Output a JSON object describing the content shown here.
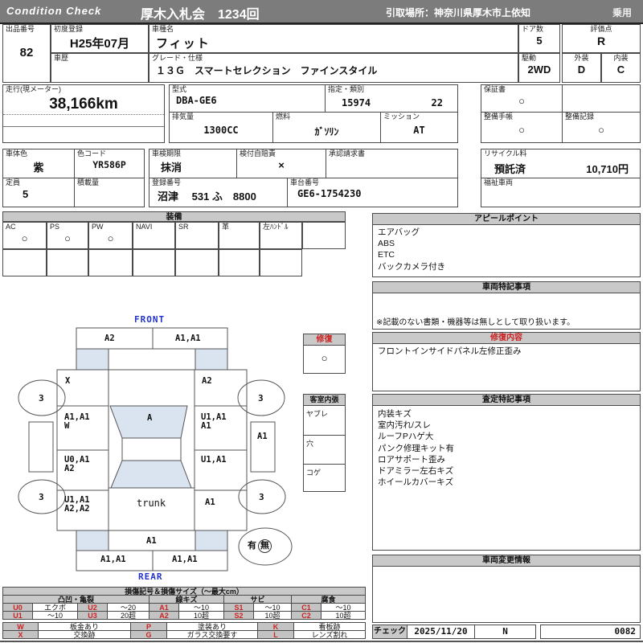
{
  "header": {
    "brand": "Condition  Check",
    "auction": "厚木入札会　1234回",
    "pickup": "引取場所：神奈川県厚木市上依知",
    "category": "乗用"
  },
  "info": {
    "lot_label": "出品番号",
    "lot_value": "82",
    "first_reg_label": "初度登録",
    "first_reg_value": "H25年07月",
    "history_label": "車歴",
    "history_value": "",
    "model_name_label": "車種名",
    "model_name_value": "フィット",
    "grade_label": "グレード・仕様",
    "grade_value": "１３Ｇ　スマートセレクション　ファインスタイル",
    "doors_label": "ドア数",
    "doors_value": "5",
    "drive_label": "駆動",
    "drive_value": "2WD",
    "score_label": "評価点",
    "score_value": "R",
    "exterior_label": "外装",
    "exterior_value": "D",
    "interior_label": "内装",
    "interior_value": "C"
  },
  "specs": {
    "mileage_label": "走行(現メーター)",
    "mileage_value": "38,166km",
    "model_code_label": "型式",
    "model_code_value": "DBA-GE6",
    "class_label": "指定・類別",
    "class_value1": "15974",
    "class_value2": "22",
    "displacement_label": "排気量",
    "displacement_value": "1300CC",
    "fuel_label": "燃料",
    "fuel_value": "ｶﾞｿﾘﾝ",
    "transmission_label": "ミッション",
    "transmission_value": "AT",
    "warranty_label": "保証書",
    "warranty_value": "○",
    "maintenance_book_label": "整備手帳",
    "maintenance_book_value": "○",
    "maintenance_record_label": "整備記録",
    "maintenance_record_value": "○"
  },
  "registration": {
    "body_color_label": "車体色",
    "body_color_value": "紫",
    "color_code_label": "色コード",
    "color_code_value": "YR586P",
    "inspection_label": "車検期限",
    "inspection_value": "抹消",
    "insurance_label": "検付自賠責",
    "insurance_value": "×",
    "approval_label": "承認請求書",
    "approval_value": "",
    "recycle_label": "リサイクル料",
    "recycle_status": "預託済",
    "recycle_fee": "10,710円",
    "capacity_label": "定員",
    "capacity_value": "5",
    "load_label": "積載量",
    "load_value": "",
    "reg_number_label": "登録番号",
    "reg_number_value": "沼津　 531 ふ　8800",
    "chassis_label": "車台番号",
    "chassis_value": "GE6-1754230",
    "welfare_label": "福祉車両",
    "welfare_value": ""
  },
  "equipment": {
    "title": "装備",
    "cols": [
      "AC",
      "PS",
      "PW",
      "NAVI",
      "SR",
      "革",
      "左ﾊﾝﾄﾞﾙ",
      ""
    ],
    "marks": [
      "○",
      "○",
      "○",
      "",
      "",
      "",
      "",
      ""
    ]
  },
  "appeal": {
    "title": "アピールポイント",
    "items": [
      "エアバッグ",
      "ABS",
      "ETC",
      "バックカメラ付き"
    ]
  },
  "vehicle_notes": {
    "title": "車両特記事項",
    "note": "※記載のない書類・機器等は無しとして取り扱います。"
  },
  "repair_details": {
    "title": "修復内容",
    "line1": "フロントインサイドパネル左修正歪み"
  },
  "assessment": {
    "title": "査定特記事項",
    "items": [
      "内装キズ",
      "室内汚れ/スレ",
      "ルーフPハゲ大",
      "パンク修理キット有",
      "ロアサポート歪み",
      "ドアミラー左右キズ",
      "ホイールカバーキズ"
    ]
  },
  "change_info": {
    "title": "車両変更情報"
  },
  "check": {
    "label": "チェック",
    "date": "2025/11/20",
    "code": "N",
    "number": "0082"
  },
  "diagram": {
    "front": "FRONT",
    "rear": "REAR",
    "front_bumper_l": "A2",
    "front_bumper_r": "A1,A1",
    "fender_l": "X",
    "fender_r": "A2",
    "windshield": "A",
    "door_fl_1": "A1,A1",
    "door_fl_mark": "W",
    "door_fr_1": "U1,A1",
    "door_fr_2": "A1",
    "sill_r": "A1",
    "door_rl_1": "U0,A1",
    "door_rl_2": "A2",
    "door_rr_1": "U1,A1",
    "quarter_l_1": "U1,A1",
    "quarter_l_2": "A2,A2",
    "trunk": "trunk",
    "quarter_r": "A1",
    "rear_panel": "A1",
    "rear_bumper_l": "A1,A1",
    "rear_bumper_r": "A1,A1",
    "tire_fl": "3",
    "tire_fr": "3",
    "tire_rl": "3",
    "tire_rr": "3",
    "spare_have": "有",
    "spare_none": "無"
  },
  "repair_box": {
    "title": "修復",
    "mark": "○"
  },
  "interior_box": {
    "title": "客室内張",
    "items": [
      "ヤブレ",
      "穴",
      "コゲ"
    ]
  },
  "legend": {
    "title": "損傷記号＆損傷サイズ（〜最大cm）",
    "groups": [
      "凸凹・亀裂",
      "線キズ",
      "サビ",
      "腐食"
    ],
    "rows": [
      [
        "U0",
        "エクボ",
        "U2",
        "〜20",
        "A1",
        "〜10",
        "S1",
        "〜10",
        "C1",
        "〜10"
      ],
      [
        "U1",
        "〜10",
        "U3",
        "20超",
        "A2",
        "10超",
        "S2",
        "10超",
        "C2",
        "10超"
      ]
    ],
    "rows2": [
      [
        "W",
        "板金あり",
        "P",
        "塗装あり",
        "K",
        "看板跡"
      ],
      [
        "X",
        "交換跡",
        "G",
        "ガラス交換要す",
        "L",
        "レンズ割れ"
      ]
    ]
  },
  "colors": {
    "accent_red": "#cc2222",
    "accent_blue": "#2233cc",
    "shade_blue": "#d9e4f0",
    "bar_gray": "#7c7c7c"
  }
}
